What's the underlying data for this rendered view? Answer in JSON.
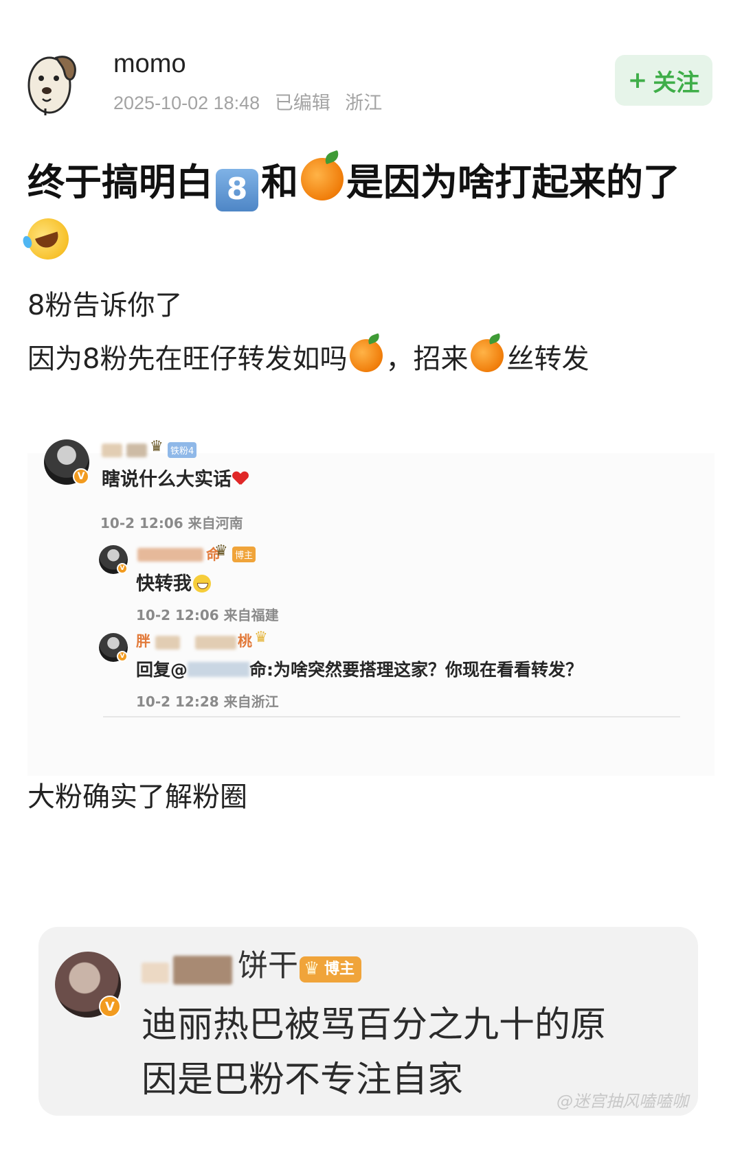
{
  "post": {
    "author": "momo",
    "date": "2025-10-02 18:48",
    "edited": "已编辑",
    "location": "浙江",
    "follow_label": "关注",
    "title_part1": "终于搞明白",
    "title_keycap": "8",
    "title_part2": "和",
    "title_part3": "是因为啥打起来的了"
  },
  "body": {
    "line1": "8粉告诉你了",
    "line2_a": "因为8粉先在旺仔转发如吗",
    "line2_b": "，招来",
    "line2_c": "丝转发",
    "line3": "大粉确实了解粉圈"
  },
  "screenshot1": {
    "comment1": {
      "tag": "铁粉4",
      "text": "瞎说什么大实话",
      "meta": "10-2 12:06 来自河南"
    },
    "reply1": {
      "name_tail": "命",
      "tag": "博主",
      "text": "快转我",
      "meta": "10-2 12:06 来自福建"
    },
    "reply2": {
      "name_head": "胖",
      "name_tail": "桃",
      "text_prefix": "回复@",
      "text_body": "命:为啥突然要搭理这家？你现在看看转发？",
      "meta": "10-2 12:28 来自浙江"
    }
  },
  "screenshot2": {
    "name_tail": "饼干",
    "tag": "博主",
    "line1": "迪丽热巴被骂百分之九十的原",
    "line2": "因是巴粉不专注自家",
    "watermark": "@迷宫抽风嗑嗑咖"
  },
  "colors": {
    "follow_green": "#3fae49",
    "follow_bg": "#e6f4e9",
    "vip_orange": "#f29b1f"
  }
}
